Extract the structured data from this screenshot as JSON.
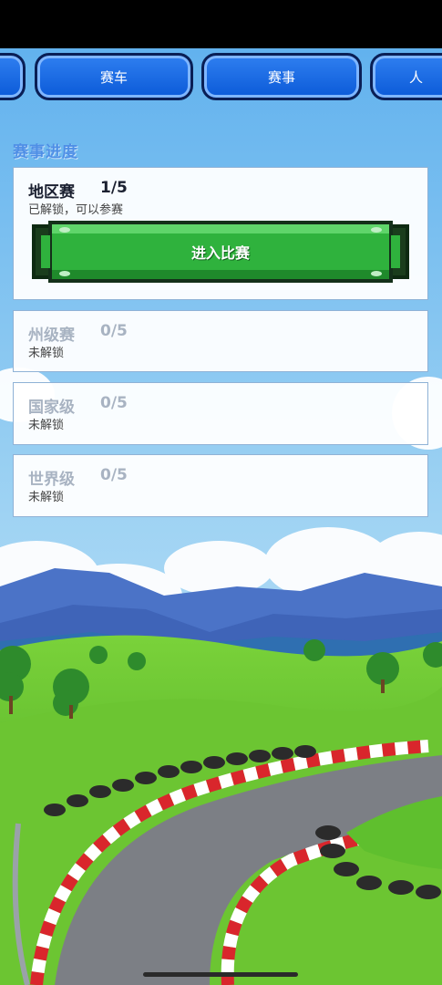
{
  "tabs": [
    {
      "label": ""
    },
    {
      "label": "赛车"
    },
    {
      "label": "赛事"
    },
    {
      "label": "人"
    }
  ],
  "section_title": "赛事进度",
  "races": [
    {
      "name": "地区赛",
      "progress": "1/5",
      "status": "已解锁，可以参赛",
      "locked": false,
      "button_label": "进入比赛"
    },
    {
      "name": "州级赛",
      "progress": "0/5",
      "status": "未解锁",
      "locked": true
    },
    {
      "name": "国家级",
      "progress": "0/5",
      "status": "未解锁",
      "locked": true
    },
    {
      "name": "世界级",
      "progress": "0/5",
      "status": "未解锁",
      "locked": true
    }
  ],
  "colors": {
    "tab_blue": "#1a6ff0",
    "button_green": "#2fb23d",
    "title_blue": "#4f8fe6",
    "locked_text": "#a8b3c2"
  }
}
